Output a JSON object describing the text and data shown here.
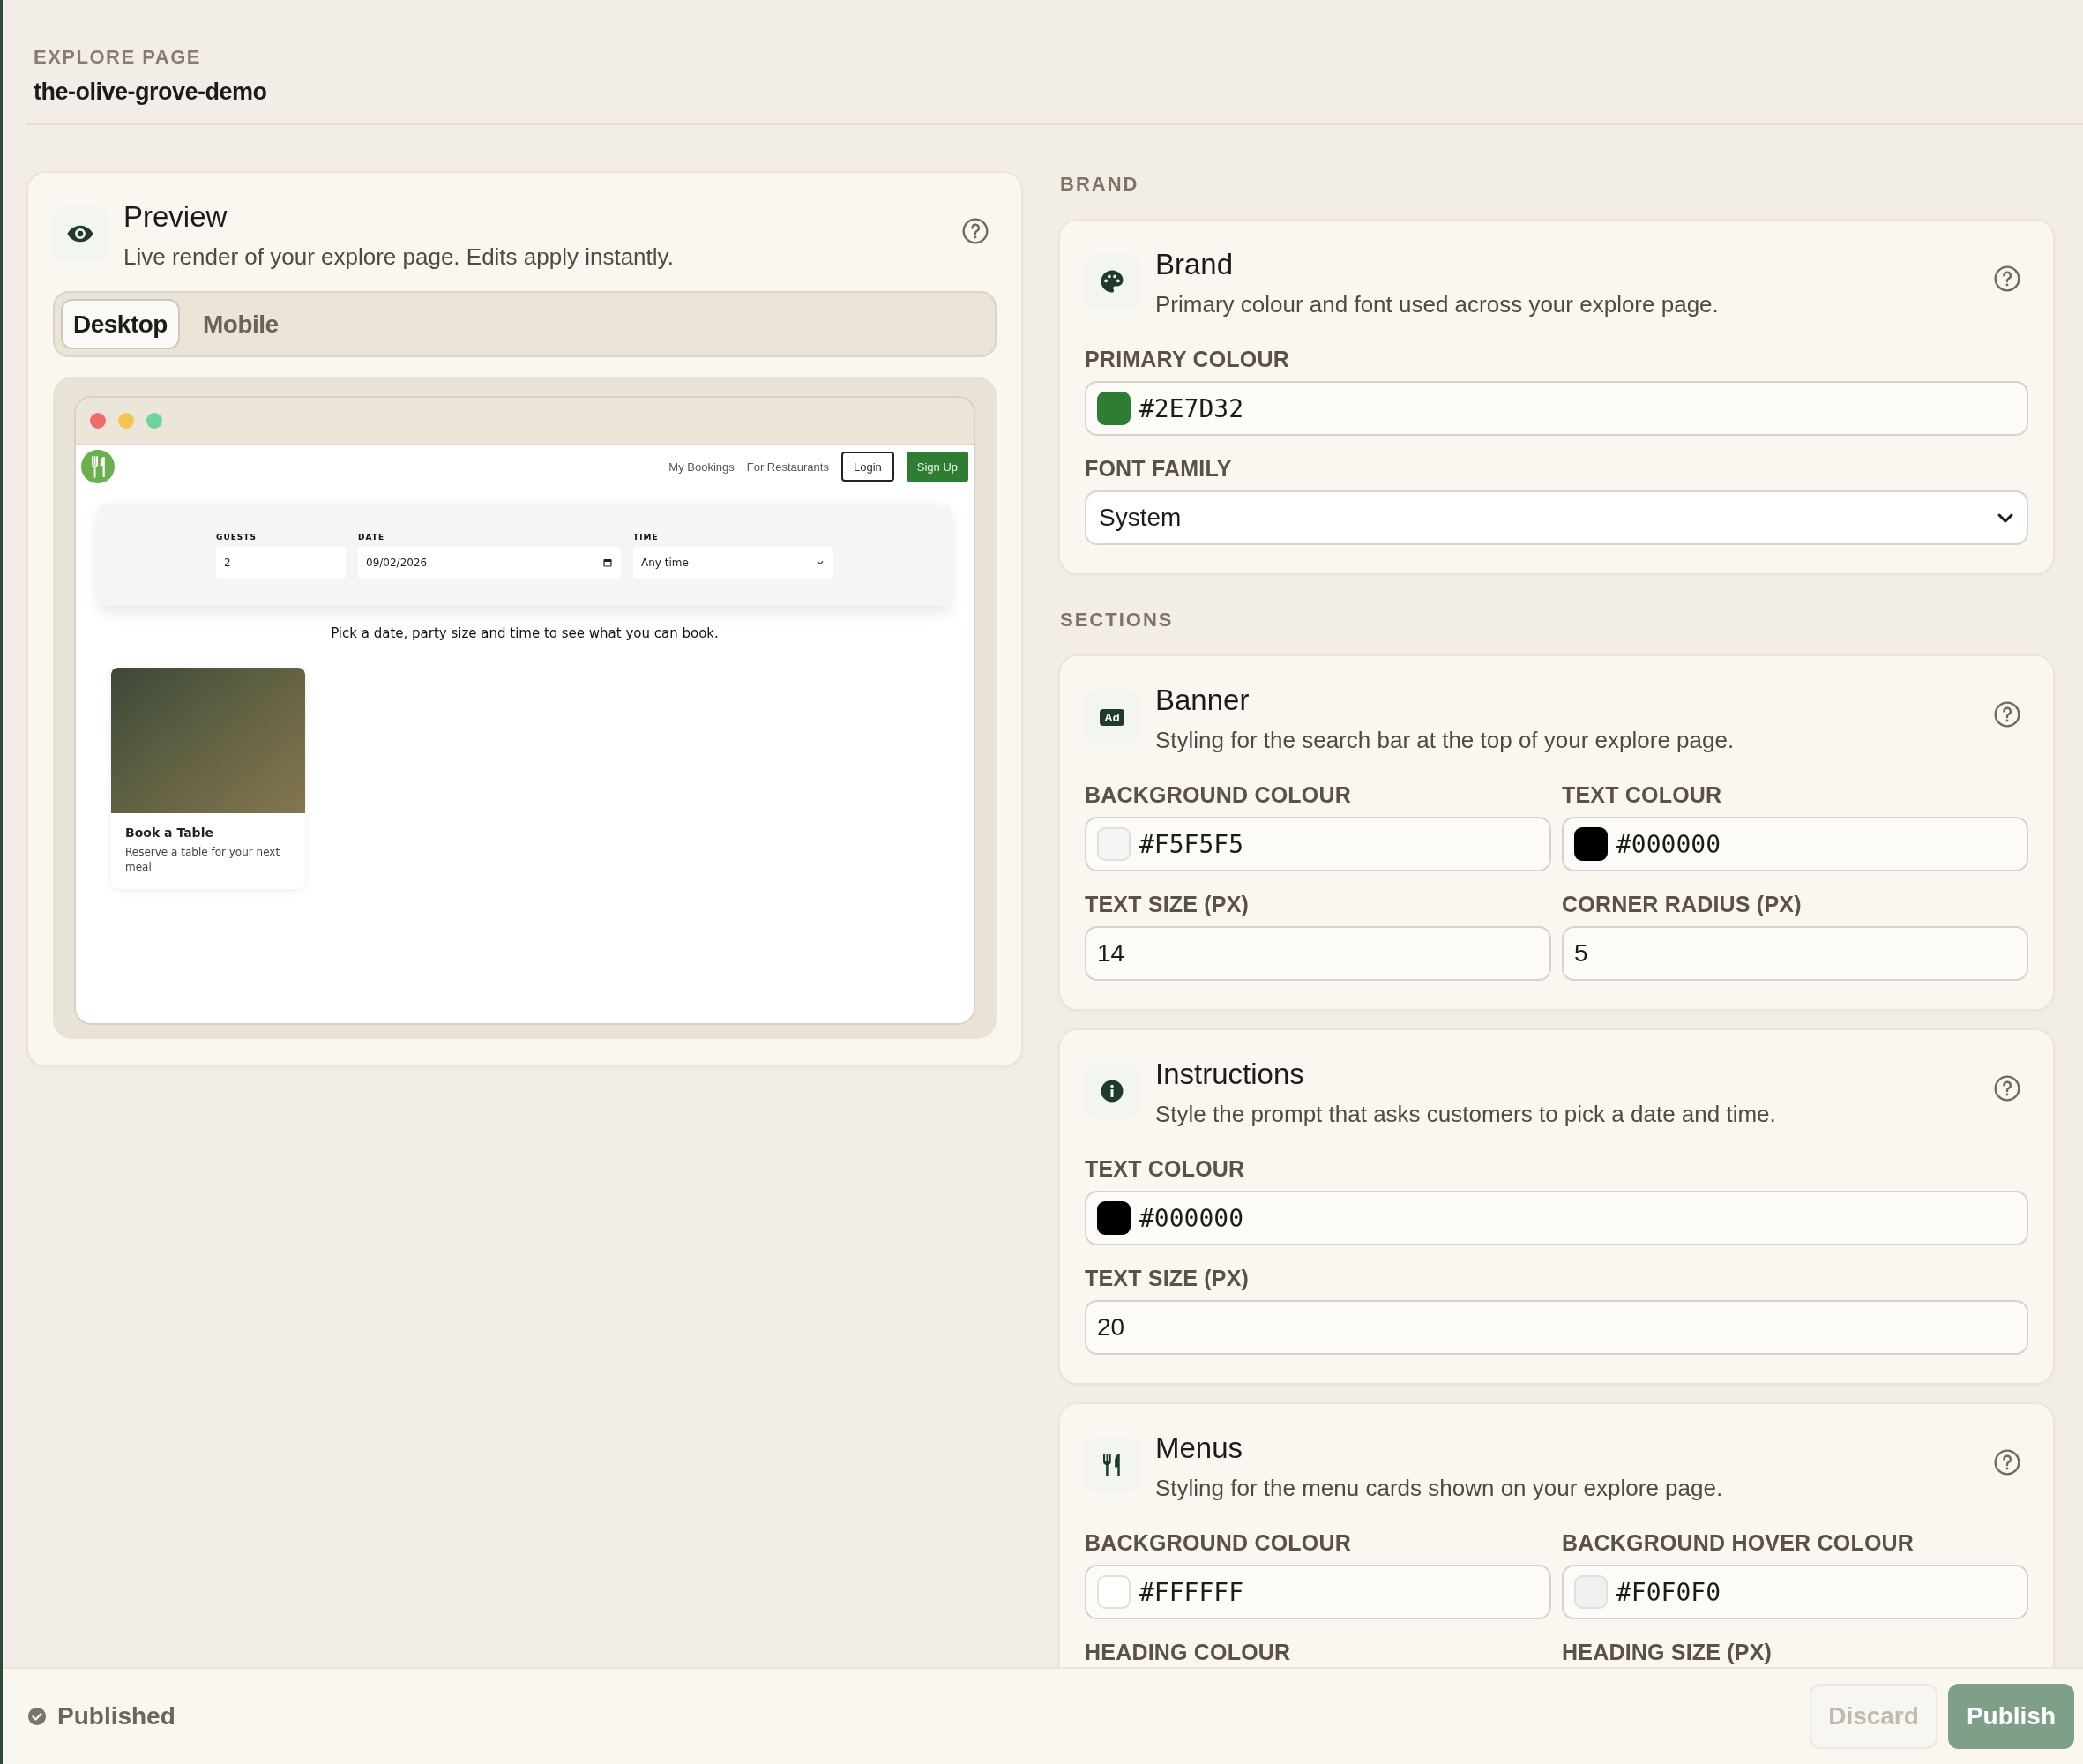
{
  "header": {
    "eyebrow": "EXPLORE PAGE",
    "slug": "the-olive-grove-demo"
  },
  "preview": {
    "title": "Preview",
    "description": "Live render of your explore page. Edits apply instantly.",
    "tabs": [
      {
        "label": "Desktop",
        "selected": true
      },
      {
        "label": "Mobile",
        "selected": false
      }
    ],
    "site": {
      "nav_links": [
        "My Bookings",
        "For Restaurants"
      ],
      "login": "Login",
      "signup": "Sign Up",
      "search_fields": [
        {
          "label": "GUESTS",
          "value": "2",
          "kind": "number"
        },
        {
          "label": "DATE",
          "value": "09/02/2026",
          "kind": "date"
        },
        {
          "label": "TIME",
          "value": "Any time",
          "kind": "select"
        }
      ],
      "prompt": "Pick a date, party size and time to see what you can book.",
      "cards": [
        {
          "title": "Book a Table",
          "description": "Reserve a table for your next meal"
        }
      ]
    }
  },
  "groups": [
    {
      "heading": "BRAND",
      "cards": [
        {
          "title": "Brand",
          "description": "Primary colour and font used across your explore page.",
          "rows": [
            [
              {
                "label": "PRIMARY COLOUR",
                "kind": "color",
                "value": "#2E7D32",
                "color": "#2e7d32"
              }
            ],
            [
              {
                "label": "FONT FAMILY",
                "kind": "select",
                "value": "System"
              }
            ]
          ]
        }
      ]
    },
    {
      "heading": "SECTIONS",
      "cards": [
        {
          "title": "Banner",
          "icon_label": "Ad",
          "description": "Styling for the search bar at the top of your explore page.",
          "rows": [
            [
              {
                "label": "BACKGROUND COLOUR",
                "kind": "color",
                "value": "#F5F5F5",
                "color": "#f5f5f5"
              },
              {
                "label": "TEXT COLOUR",
                "kind": "color",
                "value": "#000000",
                "color": "#000000"
              }
            ],
            [
              {
                "label": "TEXT SIZE (PX)",
                "kind": "number",
                "value": "14"
              },
              {
                "label": "CORNER RADIUS (PX)",
                "kind": "number",
                "value": "5"
              }
            ]
          ]
        },
        {
          "title": "Instructions",
          "description": "Style the prompt that asks customers to pick a date and time.",
          "rows": [
            [
              {
                "label": "TEXT COLOUR",
                "kind": "color",
                "value": "#000000",
                "color": "#000000"
              }
            ],
            [
              {
                "label": "TEXT SIZE (PX)",
                "kind": "number",
                "value": "20"
              }
            ]
          ]
        },
        {
          "title": "Menus",
          "description": "Styling for the menu cards shown on your explore page.",
          "rows": [
            [
              {
                "label": "BACKGROUND COLOUR",
                "kind": "color",
                "value": "#FFFFFF",
                "color": "#ffffff"
              },
              {
                "label": "BACKGROUND HOVER COLOUR",
                "kind": "color",
                "value": "#F0F0F0",
                "color": "#f0f0f0"
              }
            ],
            [
              {
                "label": "HEADING COLOUR"
              },
              {
                "label": "HEADING SIZE (PX)"
              }
            ]
          ]
        }
      ]
    }
  ],
  "status": {
    "label": "Published"
  },
  "buttons": [
    {
      "label": "Discard",
      "kind": "secondary",
      "disabled": true
    },
    {
      "label": "Publish",
      "kind": "primary",
      "disabled": true
    }
  ]
}
